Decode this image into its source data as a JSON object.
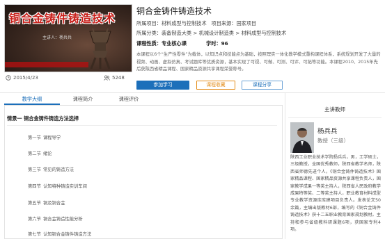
{
  "course": {
    "cover_title": "铜合金铸件铸造技术",
    "cover_authors": "主讲人：杨兵兵",
    "date": "2015/4/23",
    "views": "5248",
    "title": "铜合金铸件铸造技术",
    "project_label": "所属项目：",
    "project": "材料成型与控制技术",
    "source_label": "项目来源：",
    "source": "国家项目",
    "category_label": "所属分类：",
    "category": "装备制造大类 > 机械设计制造类 > 材料成型与控制技术",
    "nature_label": "课程性质：",
    "nature": "专业核心课",
    "hours_label": "学时：",
    "hours": "96",
    "description": "本课程以6个“生产性零件”为载体，以知识点和技能点为基础，按照理实一体化教学模式重构课程体系，系统规划开发了大量的视频、动画、虚拟仿真、考试题库等优质资源，基本实现了可视、可做、可测、可评、可拓等功能。本课程2010、2015年先后获陕西省精品课程、国家精品资源共享课程荣誉称号。"
  },
  "actions": {
    "join": "参加学习",
    "favorite": "课程收藏",
    "share": "课程分享"
  },
  "tabs": [
    "教学大纲",
    "课程简介",
    "课程评价"
  ],
  "syllabus": {
    "section": "情景一  铜合金铸件铸造方法选择",
    "items": [
      {
        "no": "第一节",
        "name": "课程导学"
      },
      {
        "no": "第二节",
        "name": "绪论"
      },
      {
        "no": "第三节",
        "name": "常见的铸造方法"
      },
      {
        "no": "第四节",
        "name": "认知特种铸造实训车间"
      },
      {
        "no": "第五节",
        "name": "铜及铜合金"
      },
      {
        "no": "第六节",
        "name": "铜合金铸造性能分析"
      },
      {
        "no": "第七节",
        "name": "认知铜合金铸件铸造方法"
      }
    ]
  },
  "teacher": {
    "heading": "主讲教师",
    "name": "杨兵兵",
    "title": "教授（三级）",
    "bio": "陕西工业职业技术学院杨兵兵，男，工学硕士，三级教授，全国优秀教师，陕西省教学名师，陕西省师德先进个人，《铜合金铸件铸造技术》国家精品课程、国家精品资源共享课程负责人，国家教学成果一等奖主持人，陕西省人民政府教学成果特等奖、二等奖主持人，职业教育材料成型专业教学资源库库建项目负责人。发表论文50余篇，主编出版教材6部，编写的《铜合金铸件铸造技术》获十二五职业教育国家规划教材。主持和参与省级教科研课题6项，获国家专利4项。"
  }
}
